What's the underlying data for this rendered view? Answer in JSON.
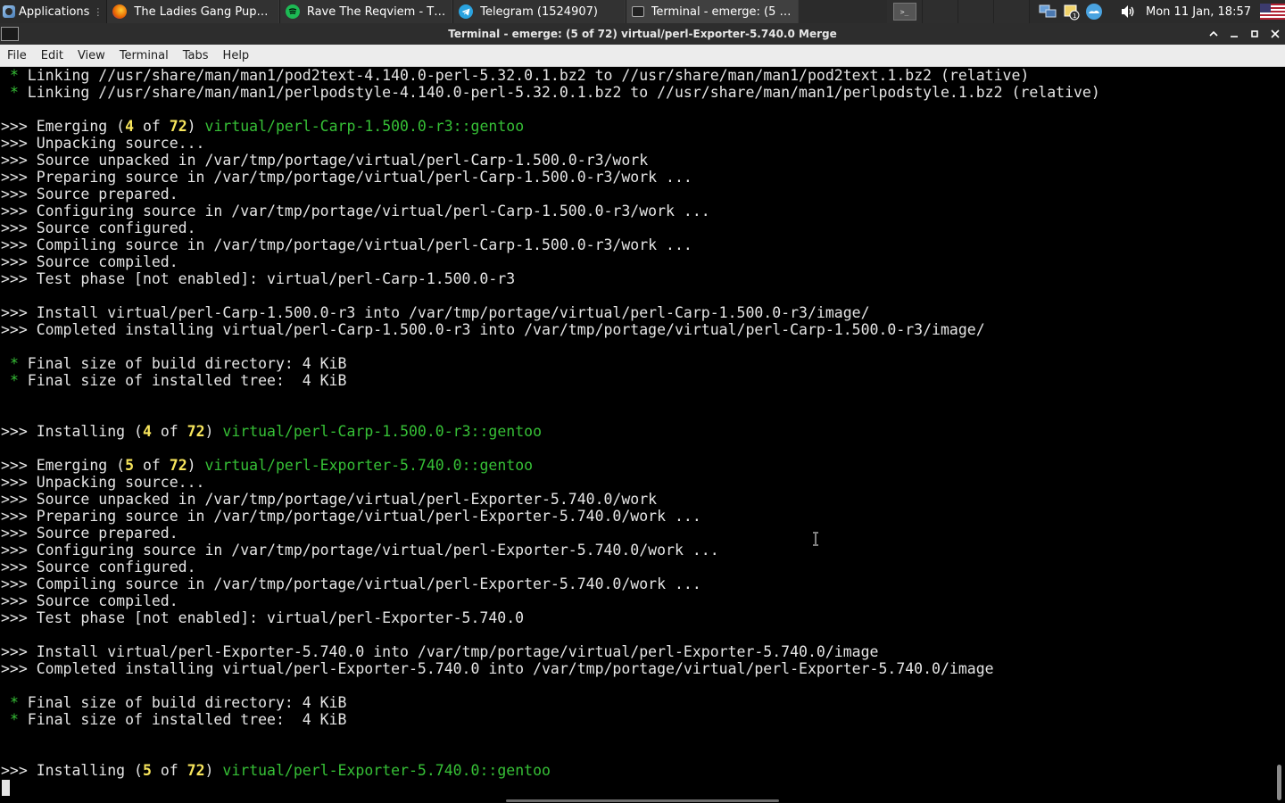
{
  "panel": {
    "applications_label": "Applications",
    "tasks": [
      {
        "label": "The Ladies Gang Puppet L...",
        "icon": "firefox-icon"
      },
      {
        "label": "Rave The Reqviem - The ...",
        "icon": "spotify-icon"
      },
      {
        "label": "Telegram (1524907)",
        "icon": "telegram-icon"
      },
      {
        "label": "Terminal - emerge: (5 of 72...",
        "icon": "terminal-icon"
      }
    ],
    "clock": "Mon 11 Jan, 18:57",
    "colors": {
      "panel_bg": "#2b2b2b",
      "spotify": "#1db954",
      "telegram": "#2aa3df",
      "firefox": "#e66000"
    }
  },
  "window": {
    "title": "Terminal - emerge: (5 of 72) virtual/perl-Exporter-5.740.0 Merge"
  },
  "menu": {
    "file": "File",
    "edit": "Edit",
    "view": "View",
    "terminal": "Terminal",
    "tabs": "Tabs",
    "help": "Help"
  },
  "terminal": {
    "colors": {
      "bg": "#000000",
      "fg": "#e5e5e5",
      "green": "#36c036",
      "yellow": "#f7e55c"
    },
    "lines": {
      "l0": {
        "star": "*",
        "text": " Linking //usr/share/man/man1/pod2text-4.140.0-perl-5.32.0.1.bz2 to //usr/share/man/man1/pod2text.1.bz2 (relative)"
      },
      "l1": {
        "star": "*",
        "text": " Linking //usr/share/man/man1/perlpodstyle-4.140.0-perl-5.32.0.1.bz2 to //usr/share/man/man1/perlpodstyle.1.bz2 (relative)"
      },
      "l3": {
        "prefix": ">>> Emerging (",
        "n": "4",
        "of": " of ",
        "total": "72",
        "close": ") ",
        "pkg": "virtual/perl-Carp-1.500.0-r3::gentoo"
      },
      "l4": ">>> Unpacking source...",
      "l5": ">>> Source unpacked in /var/tmp/portage/virtual/perl-Carp-1.500.0-r3/work",
      "l6": ">>> Preparing source in /var/tmp/portage/virtual/perl-Carp-1.500.0-r3/work ...",
      "l7": ">>> Source prepared.",
      "l8": ">>> Configuring source in /var/tmp/portage/virtual/perl-Carp-1.500.0-r3/work ...",
      "l9": ">>> Source configured.",
      "l10": ">>> Compiling source in /var/tmp/portage/virtual/perl-Carp-1.500.0-r3/work ...",
      "l11": ">>> Source compiled.",
      "l12": ">>> Test phase [not enabled]: virtual/perl-Carp-1.500.0-r3",
      "l14": ">>> Install virtual/perl-Carp-1.500.0-r3 into /var/tmp/portage/virtual/perl-Carp-1.500.0-r3/image/",
      "l15": ">>> Completed installing virtual/perl-Carp-1.500.0-r3 into /var/tmp/portage/virtual/perl-Carp-1.500.0-r3/image/",
      "l17": {
        "star": "*",
        "text": " Final size of build directory: 4 KiB"
      },
      "l18": {
        "star": "*",
        "text": " Final size of installed tree:  4 KiB"
      },
      "l21": {
        "prefix": ">>> Installing (",
        "n": "4",
        "of": " of ",
        "total": "72",
        "close": ") ",
        "pkg": "virtual/perl-Carp-1.500.0-r3::gentoo"
      },
      "l23": {
        "prefix": ">>> Emerging (",
        "n": "5",
        "of": " of ",
        "total": "72",
        "close": ") ",
        "pkg": "virtual/perl-Exporter-5.740.0::gentoo"
      },
      "l24": ">>> Unpacking source...",
      "l25": ">>> Source unpacked in /var/tmp/portage/virtual/perl-Exporter-5.740.0/work",
      "l26": ">>> Preparing source in /var/tmp/portage/virtual/perl-Exporter-5.740.0/work ...",
      "l27": ">>> Source prepared.",
      "l28": ">>> Configuring source in /var/tmp/portage/virtual/perl-Exporter-5.740.0/work ...",
      "l29": ">>> Source configured.",
      "l30": ">>> Compiling source in /var/tmp/portage/virtual/perl-Exporter-5.740.0/work ...",
      "l31": ">>> Source compiled.",
      "l32": ">>> Test phase [not enabled]: virtual/perl-Exporter-5.740.0",
      "l34": ">>> Install virtual/perl-Exporter-5.740.0 into /var/tmp/portage/virtual/perl-Exporter-5.740.0/image",
      "l35": ">>> Completed installing virtual/perl-Exporter-5.740.0 into /var/tmp/portage/virtual/perl-Exporter-5.740.0/image",
      "l37": {
        "star": "*",
        "text": " Final size of build directory: 4 KiB"
      },
      "l38": {
        "star": "*",
        "text": " Final size of installed tree:  4 KiB"
      },
      "l41": {
        "prefix": ">>> Installing (",
        "n": "5",
        "of": " of ",
        "total": "72",
        "close": ") ",
        "pkg": "virtual/perl-Exporter-5.740.0::gentoo"
      }
    }
  }
}
